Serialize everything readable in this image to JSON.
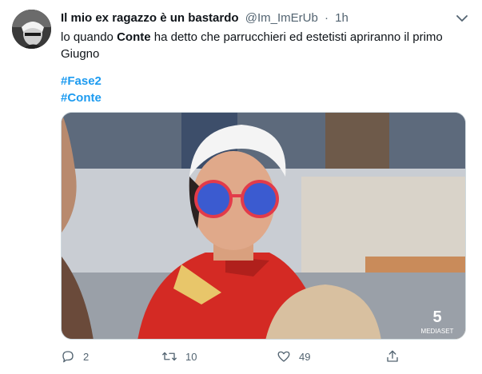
{
  "tweet": {
    "display_name": "Il mio ex ragazzo è un bastardo",
    "handle": "@Im_ImErUb",
    "separator": "·",
    "time": "1h",
    "text_before": "lo quando ",
    "text_bold": "Conte",
    "text_after": " ha detto che parrucchieri ed estetisti apriranno il primo Giugno",
    "hashtags": [
      "#Fase2",
      "#Conte"
    ],
    "media_watermark": "5 MEDIASET"
  },
  "actions": {
    "reply_count": "2",
    "retweet_count": "10",
    "like_count": "49"
  },
  "icons": {
    "more": "chevron-down-icon",
    "reply": "reply-icon",
    "retweet": "retweet-icon",
    "like": "heart-icon",
    "share": "share-icon"
  },
  "colors": {
    "link": "#1d9bf0",
    "muted": "#536471",
    "text": "#0f1419"
  }
}
